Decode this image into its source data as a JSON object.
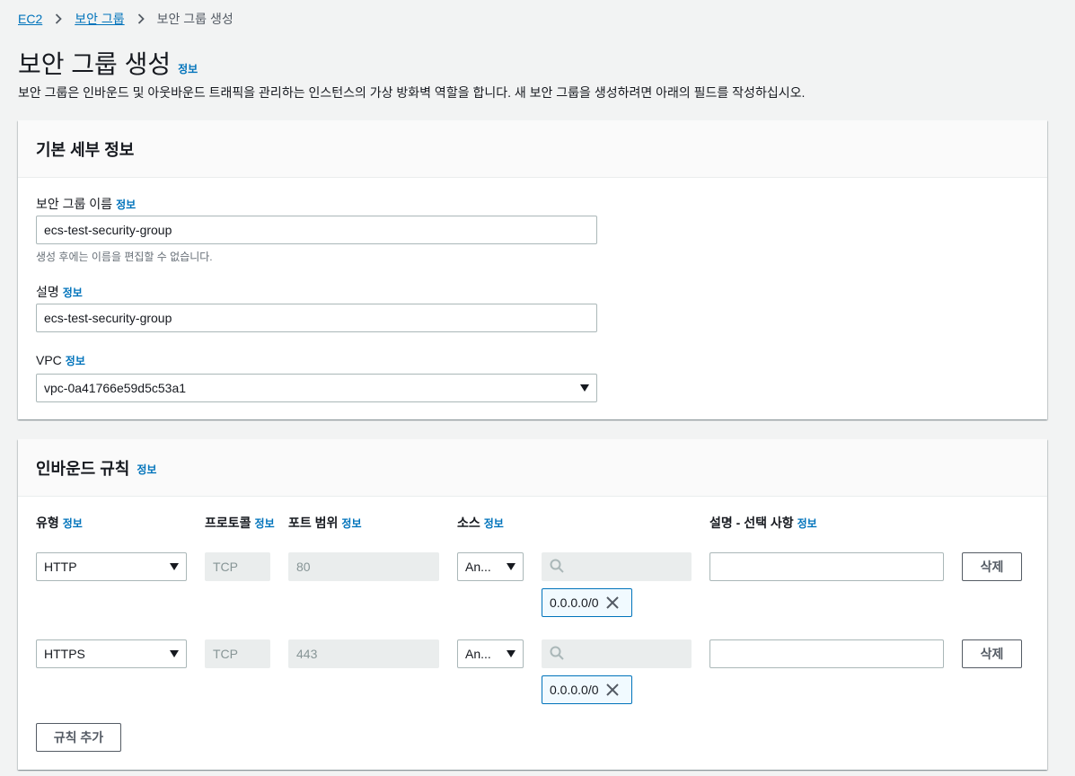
{
  "breadcrumb": {
    "items": [
      "EC2",
      "보안 그룹"
    ],
    "current": "보안 그룹 생성"
  },
  "page": {
    "title": "보안 그룹 생성",
    "info": "정보",
    "description": "보안 그룹은 인바운드 및 아웃바운드 트래픽을 관리하는 인스턴스의 가상 방화벽 역할을 합니다. 새 보안 그룹을 생성하려면 아래의 필드를 작성하십시오."
  },
  "basic": {
    "title": "기본 세부 정보",
    "name_label": "보안 그룹 이름",
    "name_value": "ecs-test-security-group",
    "name_hint": "생성 후에는 이름을 편집할 수 없습니다.",
    "desc_label": "설명",
    "desc_value": "ecs-test-security-group",
    "vpc_label": "VPC",
    "vpc_value": "vpc-0a41766e59d5c53a1",
    "info": "정보"
  },
  "inbound": {
    "title": "인바운드 규칙",
    "info": "정보",
    "columns": {
      "type": "유형",
      "protocol": "프로토콜",
      "port": "포트 범위",
      "source": "소스",
      "description": "설명 - 선택 사항"
    },
    "rules": [
      {
        "type": "HTTP",
        "protocol": "TCP",
        "port": "80",
        "source": "An...",
        "cidr": "0.0.0.0/0",
        "description": "",
        "delete": "삭제"
      },
      {
        "type": "HTTPS",
        "protocol": "TCP",
        "port": "443",
        "source": "An...",
        "cidr": "0.0.0.0/0",
        "description": "",
        "delete": "삭제"
      }
    ],
    "add_rule": "규칙 추가"
  }
}
